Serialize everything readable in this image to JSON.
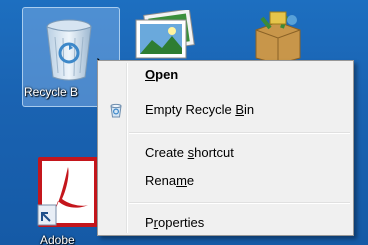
{
  "desktop": {
    "icons": [
      {
        "name": "recycle-bin",
        "label": "Recycle Bin",
        "shown_label": "Recycle B"
      },
      {
        "name": "pictures",
        "label": ""
      },
      {
        "name": "package",
        "label": ""
      },
      {
        "name": "adobe",
        "label": "Adobe"
      }
    ],
    "colors": {
      "background": "#1a63b2",
      "menu_bg": "#f0f0f0",
      "adobe_red": "#c4161c"
    }
  },
  "context_menu": {
    "items": [
      {
        "id": "open",
        "pre": "",
        "ul": "O",
        "post": "pen",
        "bold": true,
        "icon": ""
      },
      {
        "id": "empty",
        "pre": "Empty Recycle ",
        "ul": "B",
        "post": "in",
        "bold": false,
        "icon": "recycle-bin-small-icon"
      },
      {
        "id": "shortcut",
        "pre": "Create ",
        "ul": "s",
        "post": "hortcut",
        "bold": false,
        "icon": ""
      },
      {
        "id": "rename",
        "pre": "Rena",
        "ul": "m",
        "post": "e",
        "bold": false,
        "icon": ""
      },
      {
        "id": "properties",
        "pre": "P",
        "ul": "r",
        "post": "operties",
        "bold": false,
        "icon": ""
      }
    ]
  }
}
